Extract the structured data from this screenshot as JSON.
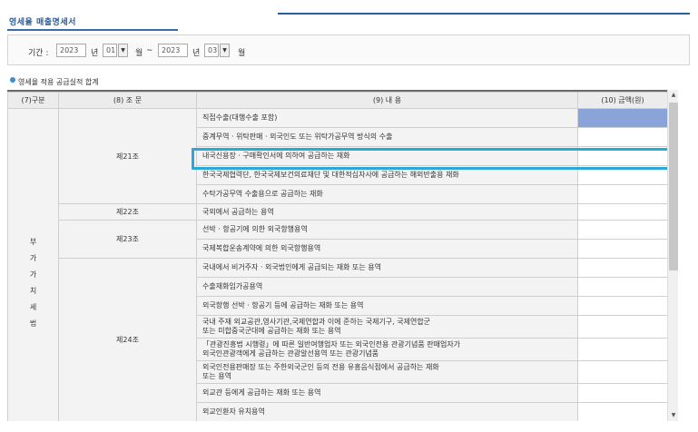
{
  "page_title": "영세율 매출명세서",
  "period": {
    "label": "기간 :",
    "start_year": "2023",
    "year_unit": "년",
    "start_month": "01",
    "month_unit": "월",
    "separator": "~",
    "end_year": "2023",
    "end_month": "03"
  },
  "section_title": "영세율 적용 공급실적 합계",
  "table": {
    "headers": [
      "(7)구분",
      "(8) 조    문",
      "(9) 내        용",
      "(10) 금액(원)"
    ],
    "category": [
      "부",
      "가",
      "가",
      "치",
      "세",
      "법"
    ],
    "articles": [
      "제21조",
      "제22조",
      "제23조",
      "제24조"
    ],
    "rows": [
      "직접수출(대행수출 포함)",
      "중계무역 · 위탁판매 · 외국인도 또는 위탁가공무역 방식의 수출",
      "내국신용장 · 구매확인서에 의하여 공급하는 재화",
      "한국국제협력단, 한국국제보건의료재단 및 대한적십자사에 공급하는 해외반출용 재화",
      "수탁가공무역 수출용으로 공급하는 재화",
      "국외에서 공급하는 용역",
      "선박 · 항공기에 의한 외국항행용역",
      "국제복합운송계약에 의한 외국항행용역",
      "국내에서 비거주자 · 외국법인에게 공급되는 재화 또는 용역",
      "수출재화임가공용역",
      "외국항행 선박 · 항공기 등에 공급하는 재화 또는 용역",
      "국내 주재 외교공관,영사기관,국제연합과 이에 준하는 국제기구, 국제연합군\n또는 미합중국군대에 공급하는 재화 또는 용역",
      "「관광진흥법 시행령」에 따른 일반여행업자 또는 외국인전용 관광기념품 판매업자가\n외국인관광객에게 공급하는 관광알선용역 또는 관광기념품",
      "외국인전용판매장 또는 주한외국군인 등의 전용 유흥음식점에서 공급하는 재화\n또는 용역",
      "외교관 등에게 공급하는 재화 또는 용역",
      "외교인환자 유치용역"
    ]
  },
  "colors": {
    "accent": "#2b5d9a",
    "highlight": "#2aa8d8",
    "amount_fill": "#8aa3d8"
  }
}
